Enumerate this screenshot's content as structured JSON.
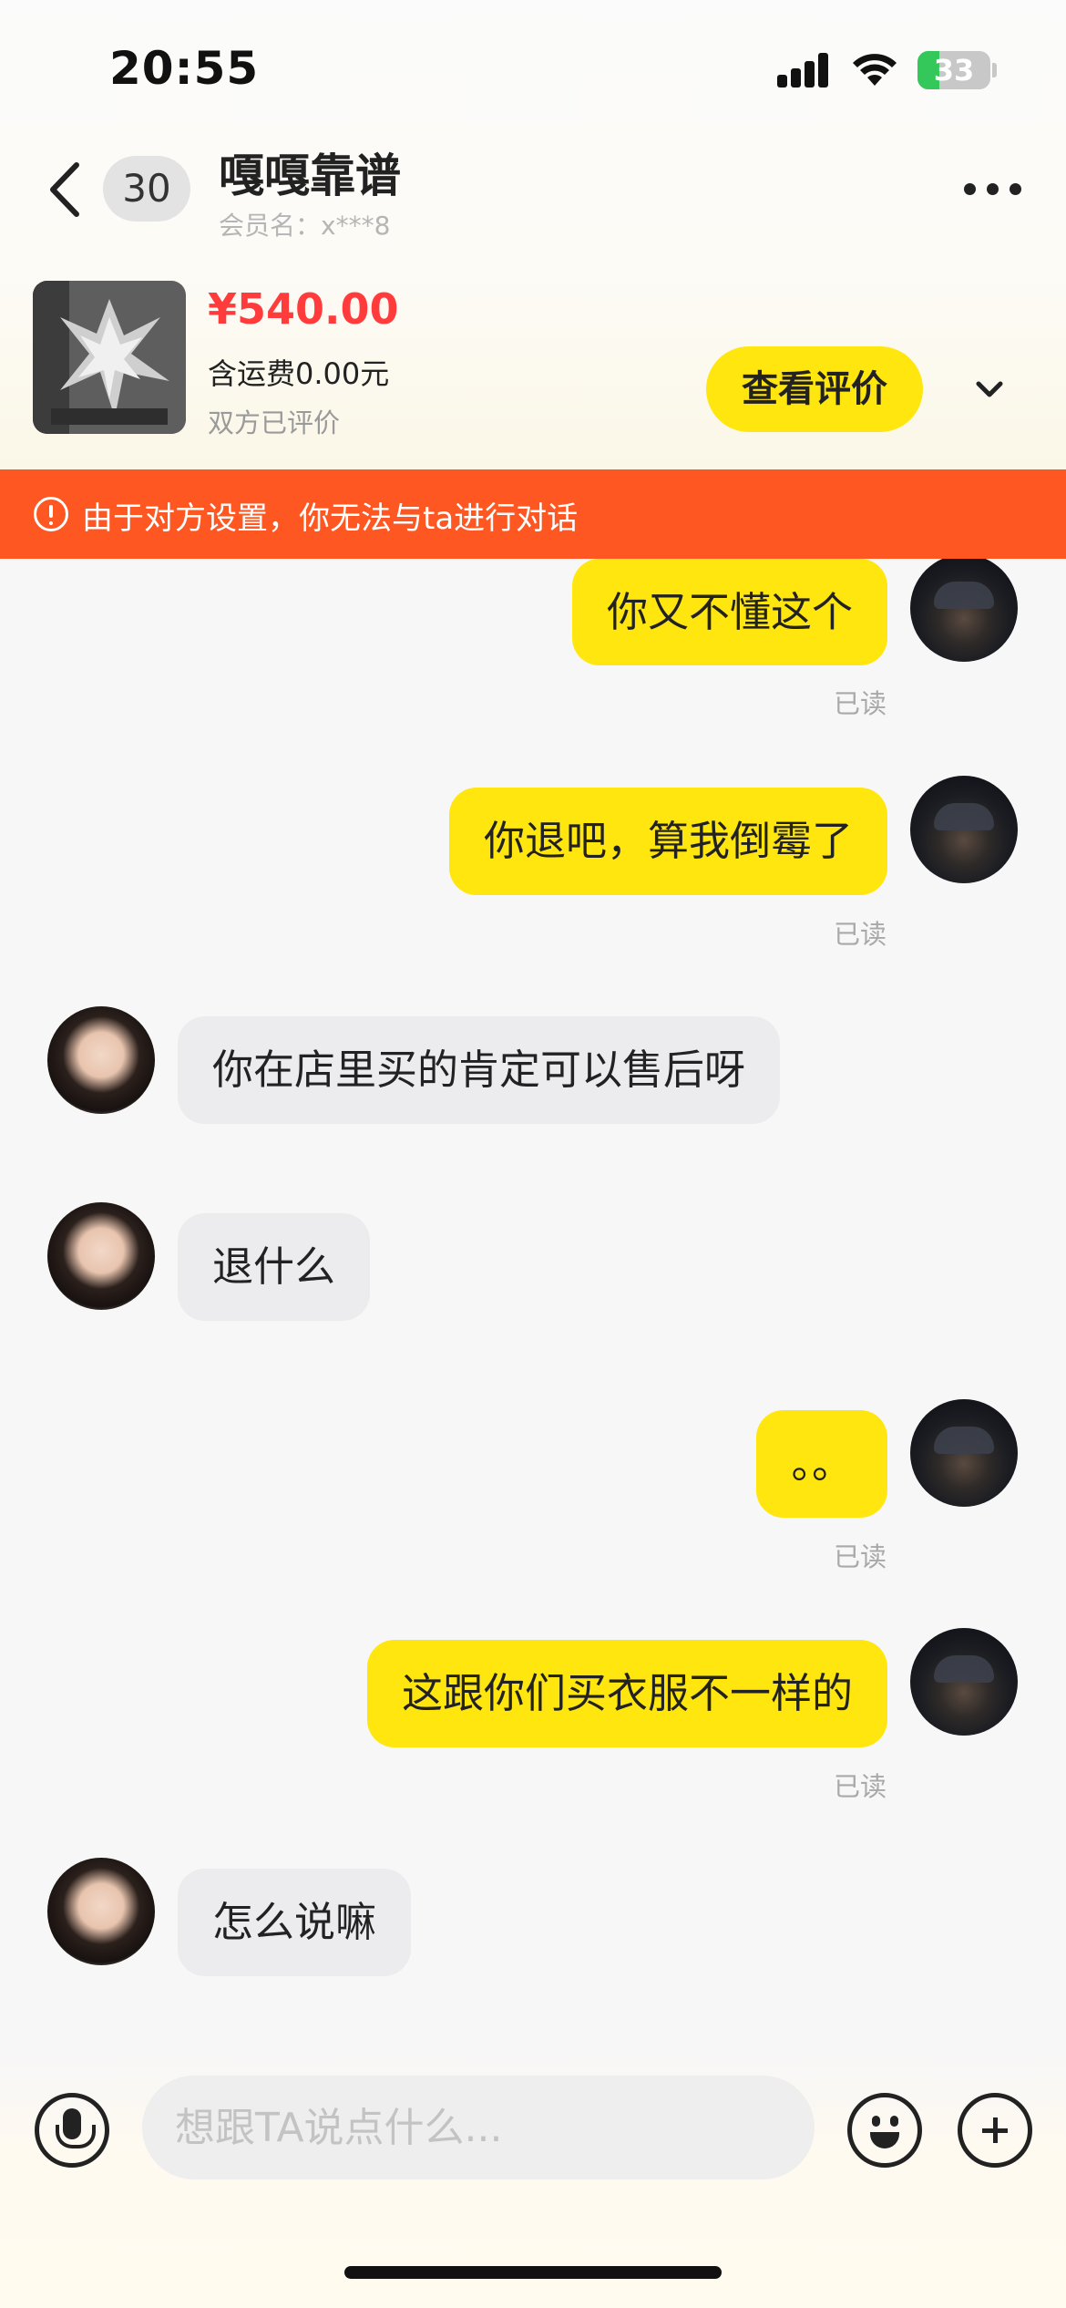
{
  "status_bar": {
    "time": "20:55",
    "battery": "33"
  },
  "header": {
    "unread_count": "30",
    "contact_name": "嘎嘎靠谱",
    "member_name": "会员名：x***8",
    "back_icon": "chevron-left-icon",
    "more_icon": "more-dots-icon"
  },
  "product": {
    "price": "¥540.00",
    "shipping": "含运费0.00元",
    "status": "双方已评价",
    "review_button": "查看评价",
    "expand_icon": "chevron-down-icon"
  },
  "warning": {
    "text": "由于对方设置，你无法与ta进行对话",
    "color": "#ff5722"
  },
  "messages": [
    {
      "from": "me",
      "text": "你又不懂这个",
      "read": "已读"
    },
    {
      "from": "me",
      "text": "你退吧，算我倒霉了",
      "read": "已读"
    },
    {
      "from": "them",
      "text": "你在店里买的肯定可以售后呀"
    },
    {
      "from": "them",
      "text": "退什么"
    },
    {
      "from": "me",
      "text": "。。",
      "read": "已读"
    },
    {
      "from": "me",
      "text": "这跟你们买衣服不一样的",
      "read": "已读"
    },
    {
      "from": "them",
      "text": "怎么说嘛"
    }
  ],
  "input": {
    "placeholder": "想跟TA说点什么..."
  },
  "colors": {
    "accent_yellow": "#ffe60f",
    "price_red": "#ff3b3b",
    "their_bubble": "#ececee"
  }
}
